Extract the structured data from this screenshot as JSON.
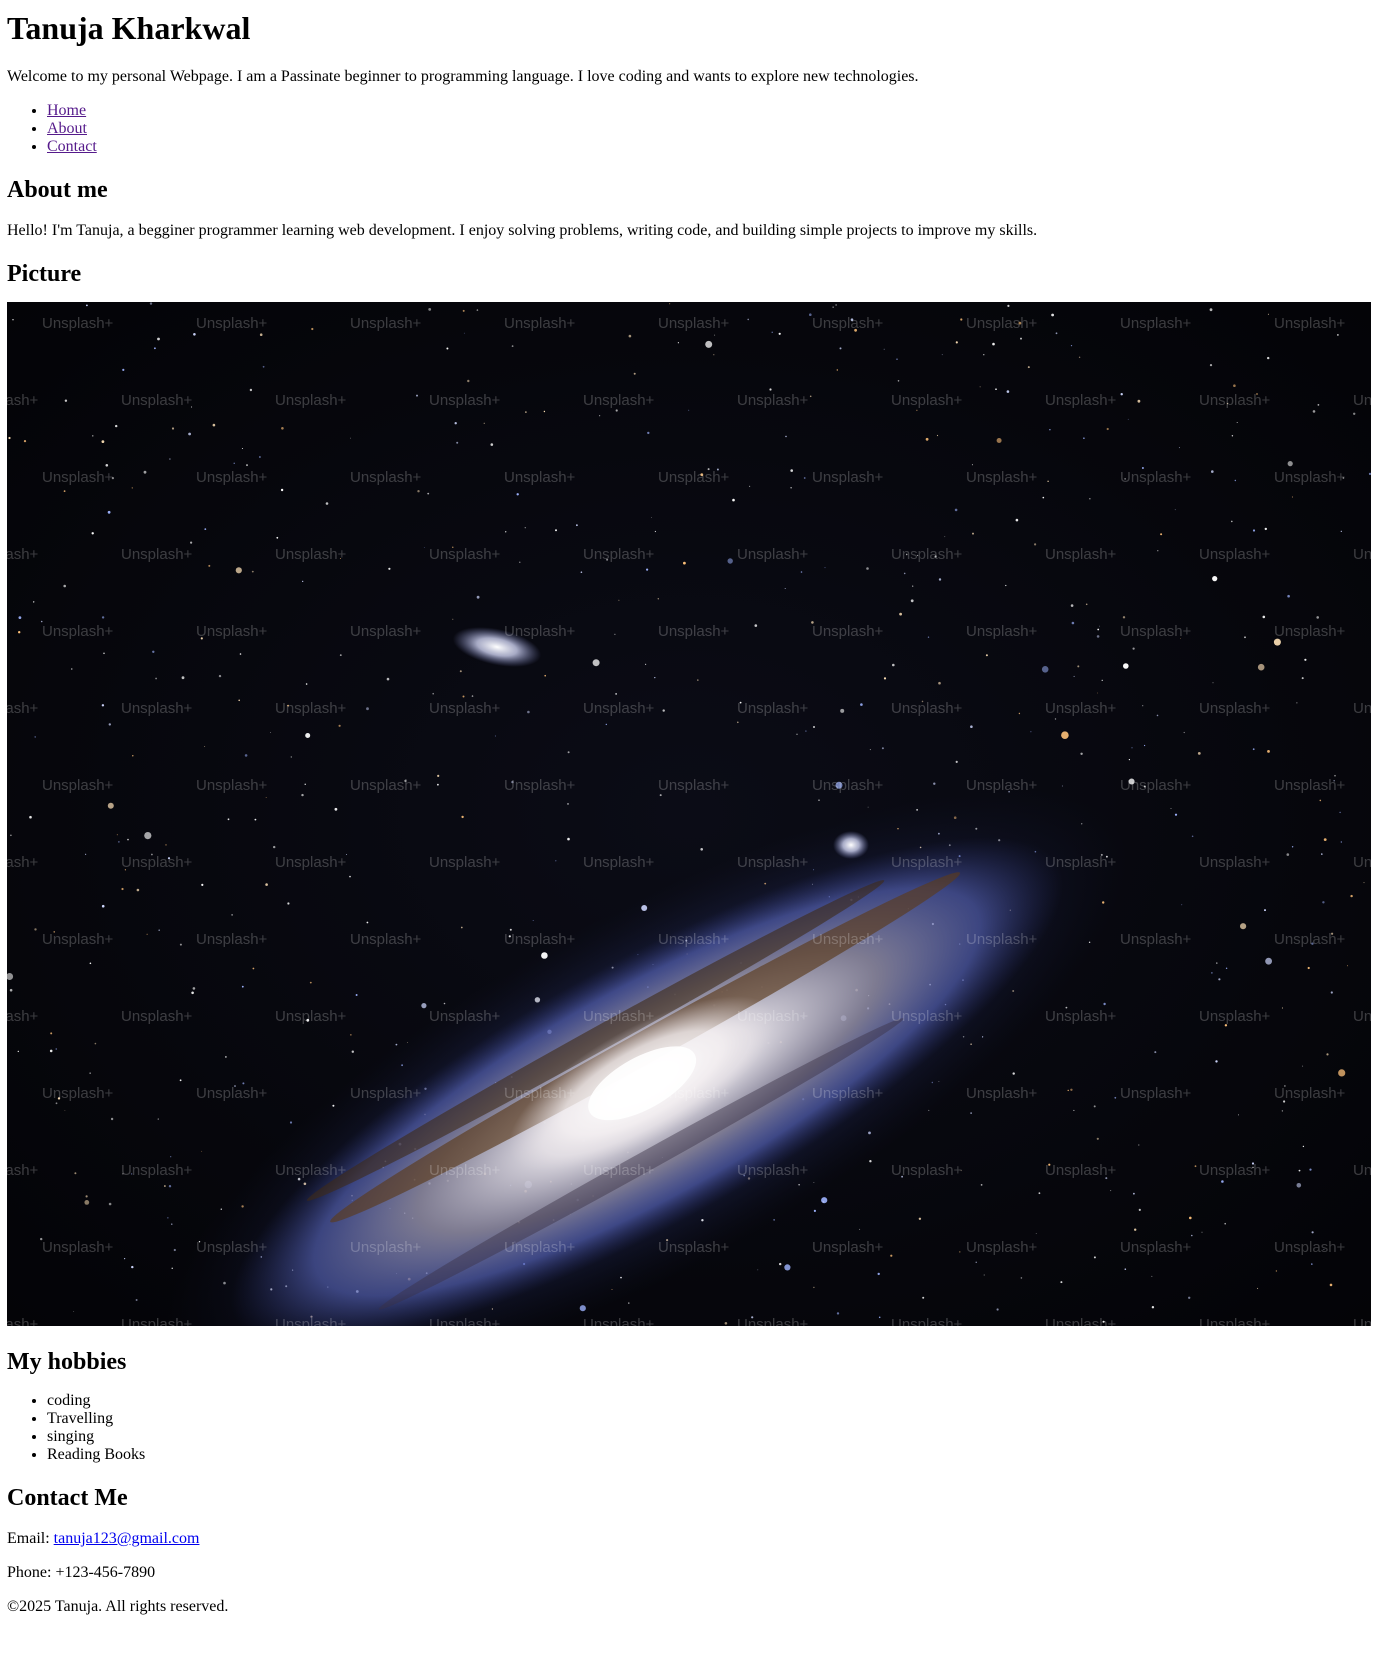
{
  "header": {
    "title": "Tanuja Kharkwal",
    "intro": "Welcome to my personal Webpage. I am a Passinate beginner to programming language. I love coding and wants to explore new technologies."
  },
  "nav": {
    "items": [
      {
        "label": "Home"
      },
      {
        "label": "About"
      },
      {
        "label": "Contact"
      }
    ],
    "link_color": "#551a8b"
  },
  "about": {
    "heading": "About me",
    "text": "Hello! I'm Tanuja, a begginer programmer learning web development. I enjoy solving problems, writing code, and building simple projects to improve my skills."
  },
  "picture": {
    "heading": "Picture",
    "image_icon": "galaxy-photo",
    "watermark": "Unsplash+"
  },
  "hobbies": {
    "heading": "My hobbies",
    "items": [
      "coding",
      "Travelling",
      "singing",
      "Reading Books"
    ]
  },
  "contact": {
    "heading": "Contact Me",
    "email_label": "Email: ",
    "email": "tanuja123@gmail.com",
    "phone": "Phone: +123-456-7890",
    "link_color": "#0000ee"
  },
  "footer": {
    "text": "©2025 Tanuja. All rights reserved."
  }
}
